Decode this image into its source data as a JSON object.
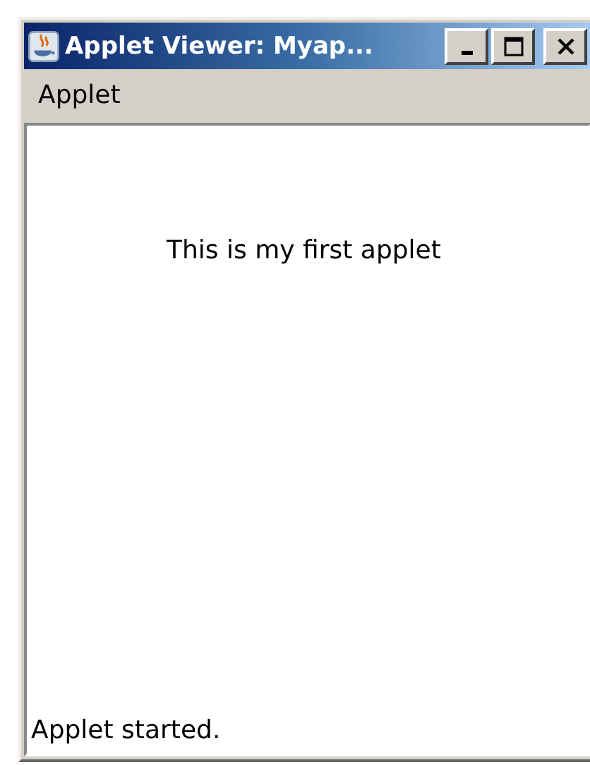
{
  "window": {
    "title": "Applet Viewer: Myap..."
  },
  "menu_bar": {
    "items": [
      "Applet"
    ]
  },
  "applet": {
    "text": "This is my first applet"
  },
  "status_bar": {
    "text": "Applet started."
  }
}
